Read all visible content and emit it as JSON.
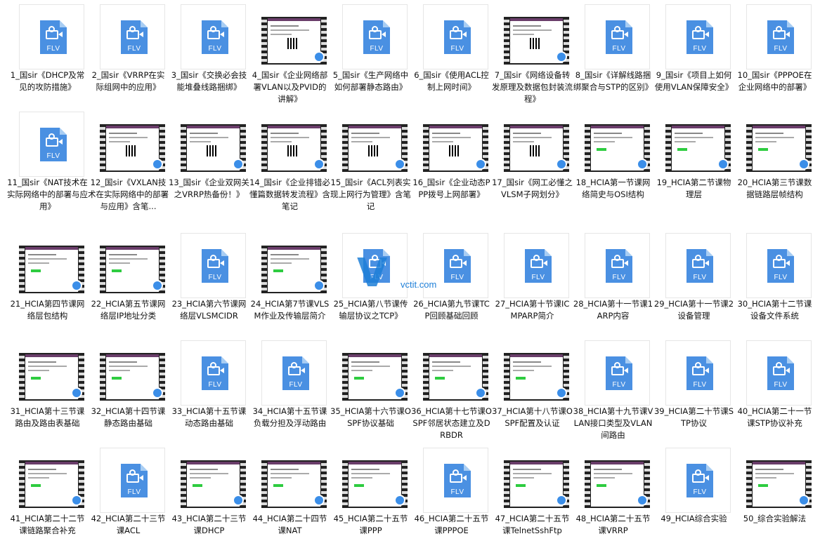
{
  "icon_label": "FLV",
  "watermark": {
    "mark": "V",
    "text": "vctit.com"
  },
  "files": [
    {
      "name": "1_国sir《DHCP及常见的攻防措施》",
      "kind": "flv"
    },
    {
      "name": "2_国sir《VRRP在实际组网中的应用》",
      "kind": "flv"
    },
    {
      "name": "3_国sir《交换必会技能堆叠线路捆绑》",
      "kind": "flv"
    },
    {
      "name": "4_国sir《企业网络部署VLAN以及PVID的讲解》",
      "kind": "video"
    },
    {
      "name": "5_国sir《生产网络中如何部署静态路由》",
      "kind": "flv"
    },
    {
      "name": "6_国sir《使用ACL控制上网时间》",
      "kind": "flv"
    },
    {
      "name": "7_国sir《网络设备转发原理及数据包封装流程》",
      "kind": "video"
    },
    {
      "name": "8_国sir《详解线路捆绑聚合与STP的区别》",
      "kind": "flv"
    },
    {
      "name": "9_国sir《项目上如何使用VLAN保障安全》",
      "kind": "flv"
    },
    {
      "name": "10_国sir《PPPOE在企业网络中的部署》",
      "kind": "flv"
    },
    {
      "name": "11_国sir《NAT技术在实际网络中的部署与应用》",
      "kind": "flv"
    },
    {
      "name": "12_国sir《VXLAN技术在实际网络中的部署与应用》含笔...",
      "kind": "video"
    },
    {
      "name": "13_国sir《企业双网关之VRRP热备份！》",
      "kind": "video"
    },
    {
      "name": "14_国sir《企业排错必懂篇数据转发流程》含笔记",
      "kind": "video"
    },
    {
      "name": "15_国sir《ACL列表实现上网行为管理》含笔记",
      "kind": "video"
    },
    {
      "name": "16_国sir《企业动态PPP拨号上网部署》",
      "kind": "video"
    },
    {
      "name": "17_国sir《网工必懂之VLSM子网划分》",
      "kind": "video"
    },
    {
      "name": "18_HCIA第一节课网络简史与OSI结构",
      "kind": "video"
    },
    {
      "name": "19_HCIA第二节课物理层",
      "kind": "video"
    },
    {
      "name": "20_HCIA第三节课数据链路层帧结构",
      "kind": "video"
    },
    {
      "name": "21_HCIA第四节课网络层包结构",
      "kind": "video"
    },
    {
      "name": "22_HCIA第五节课网络层IP地址分类",
      "kind": "video"
    },
    {
      "name": "23_HCIA第六节课网络层VLSMCIDR",
      "kind": "flv"
    },
    {
      "name": "24_HCIA第7节课VLSM作业及传输层简介",
      "kind": "video"
    },
    {
      "name": "25_HCIA第八节课传输层协议之TCP》",
      "kind": "flv"
    },
    {
      "name": "26_HCIA第九节课TCP回顾基础回顾",
      "kind": "flv"
    },
    {
      "name": "27_HCIA第十节课ICMPARP简介",
      "kind": "flv"
    },
    {
      "name": "28_HCIA第十一节课1ARP内容",
      "kind": "flv"
    },
    {
      "name": "29_HCIA第十一节课2设备管理",
      "kind": "flv"
    },
    {
      "name": "30_HCIA第十二节课设备文件系统",
      "kind": "flv"
    },
    {
      "name": "31_HCIA第十三节课路由及路由表基础",
      "kind": "video"
    },
    {
      "name": "32_HCIA第十四节课静态路由基础",
      "kind": "video"
    },
    {
      "name": "33_HCIA第十五节课动态路由基础",
      "kind": "flv"
    },
    {
      "name": "34_HCIA第十五节课负载分担及浮动路由",
      "kind": "flv"
    },
    {
      "name": "35_HCIA第十六节课OSPF协议基础",
      "kind": "video"
    },
    {
      "name": "36_HCIA第十七节课OSPF邻居状态建立及DRBDR",
      "kind": "video"
    },
    {
      "name": "37_HCIA第十八节课OSPF配置及认证",
      "kind": "video"
    },
    {
      "name": "38_HCIA第十九节课VLAN接口类型及VLAN间路由",
      "kind": "flv"
    },
    {
      "name": "39_HCIA第二十节课STP协议",
      "kind": "flv"
    },
    {
      "name": "40_HCIA第二十一节课STP协议补充",
      "kind": "flv"
    },
    {
      "name": "41_HCIA第二十二节课链路聚合补充",
      "kind": "video"
    },
    {
      "name": "42_HCIA第二十三节课ACL",
      "kind": "flv"
    },
    {
      "name": "43_HCIA第二十三节课DHCP",
      "kind": "video"
    },
    {
      "name": "44_HCIA第二十四节课NAT",
      "kind": "video"
    },
    {
      "name": "45_HCIA第二十五节课PPP",
      "kind": "video"
    },
    {
      "name": "46_HCIA第二十五节课PPPOE",
      "kind": "flv"
    },
    {
      "name": "47_HCIA第二十五节课TelnetSshFtp",
      "kind": "video"
    },
    {
      "name": "48_HCIA第二十五节课VRRP",
      "kind": "video"
    },
    {
      "name": "49_HCIA综合实验",
      "kind": "flv"
    },
    {
      "name": "50_综合实验解法",
      "kind": "video"
    }
  ]
}
